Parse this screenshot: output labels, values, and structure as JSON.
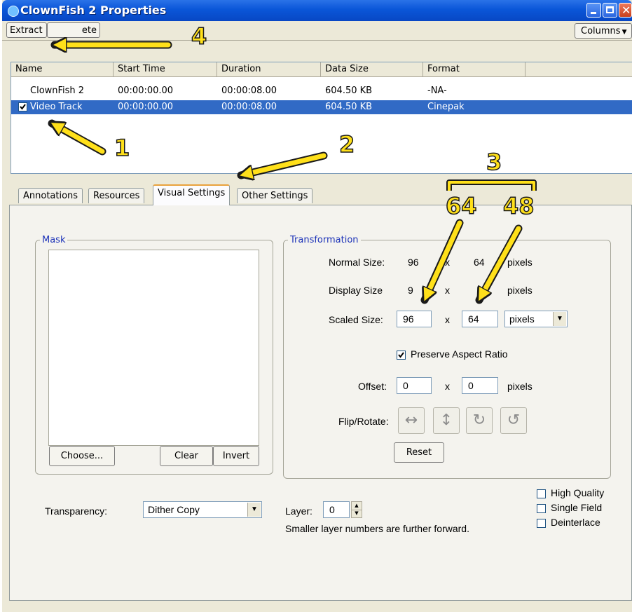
{
  "window": {
    "title": "ClownFish 2 Properties",
    "controls": {
      "minimize": "minimize-icon",
      "maximize": "maximize-icon",
      "close": "close-icon"
    }
  },
  "toolbar": {
    "extract_label": "Extract",
    "delete_label": "ete",
    "columns_label": "Columns"
  },
  "tracks": {
    "columns": [
      "Name",
      "Start Time",
      "Duration",
      "Data Size",
      "Format"
    ],
    "rows": [
      {
        "name": "ClownFish 2",
        "start": "00:00:00.00",
        "duration": "00:00:08.00",
        "size": "604.50 KB",
        "format": "-NA-",
        "selected": false
      },
      {
        "name": "Video Track",
        "start": "00:00:00.00",
        "duration": "00:00:08.00",
        "size": "604.50 KB",
        "format": "Cinepak",
        "selected": true,
        "checked": true
      }
    ]
  },
  "tabs": [
    {
      "label": "Annotations",
      "active": false
    },
    {
      "label": "Resources",
      "active": false
    },
    {
      "label": "Visual Settings",
      "active": true
    },
    {
      "label": "Other Settings",
      "active": false
    }
  ],
  "mask": {
    "legend": "Mask",
    "choose_label": "Choose...",
    "clear_label": "Clear",
    "invert_label": "Invert"
  },
  "transformation": {
    "legend": "Transformation",
    "normal_size": {
      "label": "Normal Size:",
      "width": "96",
      "x": "x",
      "height": "64",
      "unit": "pixels"
    },
    "display_size": {
      "label": "Display Size",
      "width": "9",
      "x": "x",
      "unit": "pixels"
    },
    "scaled_size": {
      "label": "Scaled Size:",
      "width": "96",
      "x": "x",
      "height": "64",
      "unit": "pixels"
    },
    "preserve_aspect": {
      "label": "Preserve Aspect Ratio",
      "checked": true
    },
    "offset": {
      "label": "Offset:",
      "x_value": "0",
      "x": "x",
      "y_value": "0",
      "unit": "pixels"
    },
    "flip_rotate": {
      "label": "Flip/Rotate:",
      "glyphs": [
        "↔",
        "↕",
        "↻",
        "↺"
      ]
    },
    "reset_label": "Reset"
  },
  "transparency": {
    "label": "Transparency:",
    "value": "Dither Copy"
  },
  "layer": {
    "label": "Layer:",
    "value": "0",
    "note": "Smaller layer numbers are further forward."
  },
  "options": [
    {
      "label": "High Quality",
      "checked": false
    },
    {
      "label": "Single Field",
      "checked": false
    },
    {
      "label": "Deinterlace",
      "checked": false
    }
  ],
  "annotations": {
    "n1": "1",
    "n2": "2",
    "n3": "3",
    "n4": "4",
    "val64": "64",
    "val48": "48",
    "color": "#ffe01a"
  }
}
